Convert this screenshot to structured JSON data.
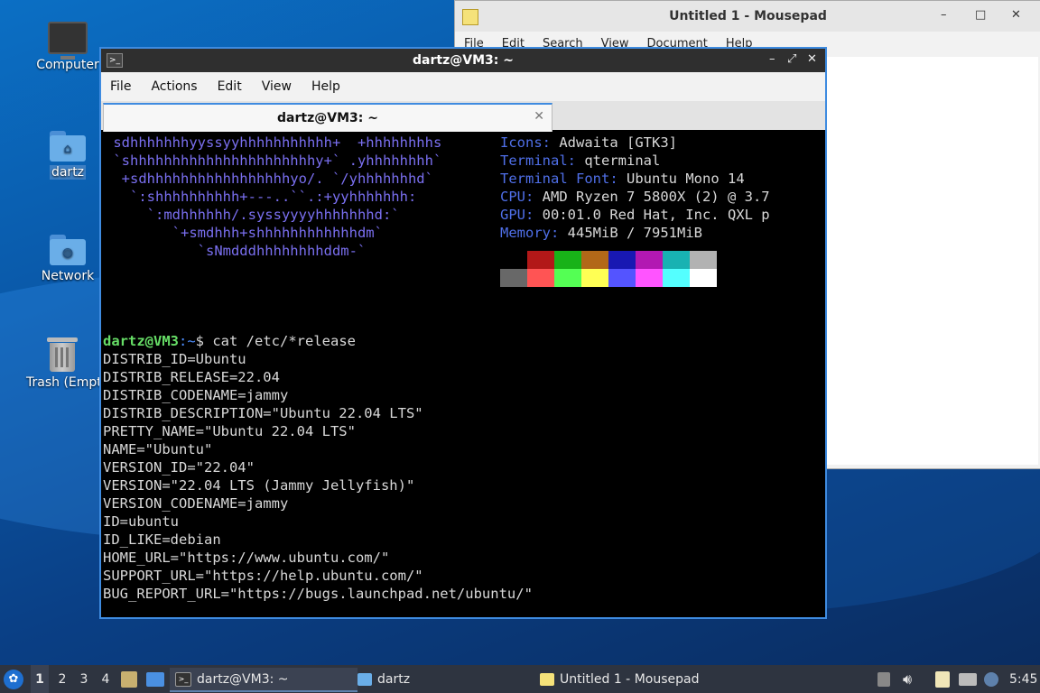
{
  "desktop": {
    "icons": [
      {
        "label": "Computer",
        "icon": "computer-icon"
      },
      {
        "label": "dartz",
        "icon": "home-folder-icon"
      },
      {
        "label": "Network",
        "icon": "network-folder-icon"
      },
      {
        "label": "Trash (Empty)",
        "icon": "trash-icon"
      }
    ]
  },
  "mousepad": {
    "title": "Untitled 1 - Mousepad",
    "menu": [
      "File",
      "Edit",
      "Search",
      "View",
      "Document",
      "Help"
    ],
    "controls": {
      "minimize": "–",
      "maximize": "□",
      "close": "✕"
    }
  },
  "terminal": {
    "title": "dartz@VM3: ~",
    "tab_title": "dartz@VM3: ~",
    "tab_close": "✕",
    "menu": [
      "File",
      "Actions",
      "Edit",
      "View",
      "Help"
    ],
    "controls": {
      "minimize": "–",
      "maximize": "⤢",
      "close": "✕"
    },
    "ascii_art": [
      " sdhhhhhhhyyssyyhhhhhhhhhhh+  +hhhhhhhhs",
      " `shhhhhhhhhhhhhhhhhhhhhhy+` .yhhhhhhhh`",
      "  +sdhhhhhhhhhhhhhhhhhyo/. `/yhhhhhhhd`",
      "   `:shhhhhhhhhh+---..``.:+yyhhhhhhh:",
      "     `:mdhhhhhh/.syssyyyyhhhhhhhd:`",
      "        `+smdhhh+shhhhhhhhhhhhdm`",
      "           `sNmdddhhhhhhhhddm-`"
    ],
    "info": [
      {
        "key": "Icons",
        "value": "Adwaita [GTK3]"
      },
      {
        "key": "Terminal",
        "value": "qterminal"
      },
      {
        "key": "Terminal Font",
        "value": "Ubuntu Mono 14"
      },
      {
        "key": "CPU",
        "value": "AMD Ryzen 7 5800X (2) @ 3.7"
      },
      {
        "key": "GPU",
        "value": "00:01.0 Red Hat, Inc. QXL p"
      },
      {
        "key": "Memory",
        "value": "445MiB / 7951MiB"
      }
    ],
    "palette_top": [
      "#000000",
      "#b21818",
      "#18b218",
      "#b26818",
      "#1818b2",
      "#b218b2",
      "#18b2b2",
      "#b2b2b2"
    ],
    "palette_bottom": [
      "#686868",
      "#ff5454",
      "#54ff54",
      "#ffff54",
      "#5454ff",
      "#ff54ff",
      "#54ffff",
      "#ffffff"
    ],
    "prompt_user": "dartz@VM3",
    "prompt_path": ":~",
    "prompt_symbol": "$ ",
    "command": "cat /etc/*release",
    "output": [
      "DISTRIB_ID=Ubuntu",
      "DISTRIB_RELEASE=22.04",
      "DISTRIB_CODENAME=jammy",
      "DISTRIB_DESCRIPTION=\"Ubuntu 22.04 LTS\"",
      "PRETTY_NAME=\"Ubuntu 22.04 LTS\"",
      "NAME=\"Ubuntu\"",
      "VERSION_ID=\"22.04\"",
      "VERSION=\"22.04 LTS (Jammy Jellyfish)\"",
      "VERSION_CODENAME=jammy",
      "ID=ubuntu",
      "ID_LIKE=debian",
      "HOME_URL=\"https://www.ubuntu.com/\"",
      "SUPPORT_URL=\"https://help.ubuntu.com/\"",
      "BUG_REPORT_URL=\"https://bugs.launchpad.net/ubuntu/\""
    ]
  },
  "taskbar": {
    "workspaces": [
      "1",
      "2",
      "3",
      "4"
    ],
    "tasks": [
      {
        "label": "dartz@VM3: ~",
        "icon": "terminal-icon"
      },
      {
        "label": "dartz",
        "icon": "folder-icon"
      },
      {
        "label": "Untitled 1 - Mousepad",
        "icon": "text-editor-icon"
      }
    ],
    "clock": "5:45"
  }
}
